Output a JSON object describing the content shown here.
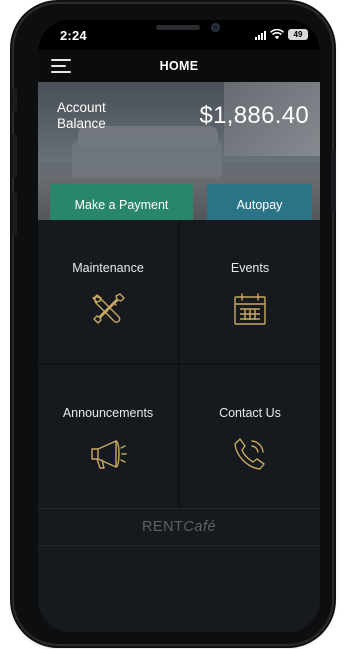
{
  "status_bar": {
    "time": "2:24",
    "battery": "49"
  },
  "header": {
    "title": "HOME",
    "menu_icon": "hamburger-menu-icon"
  },
  "account": {
    "label_line1": "Account",
    "label_line2": "Balance",
    "balance": "$1,886.40"
  },
  "actions": {
    "pay_label": "Make a Payment",
    "autopay_label": "Autopay",
    "pay_color": "#28876a",
    "autopay_color": "#2b7387"
  },
  "tiles": [
    {
      "label": "Maintenance",
      "icon": "wrench-screwdriver-icon"
    },
    {
      "label": "Events",
      "icon": "calendar-icon"
    },
    {
      "label": "Announcements",
      "icon": "megaphone-icon"
    },
    {
      "label": "Contact Us",
      "icon": "phone-icon"
    }
  ],
  "footer": {
    "brand_prefix": "RENT",
    "brand_suffix": "Café"
  },
  "colors": {
    "accent_gold": "#c9a961",
    "background": "#161a1e"
  }
}
